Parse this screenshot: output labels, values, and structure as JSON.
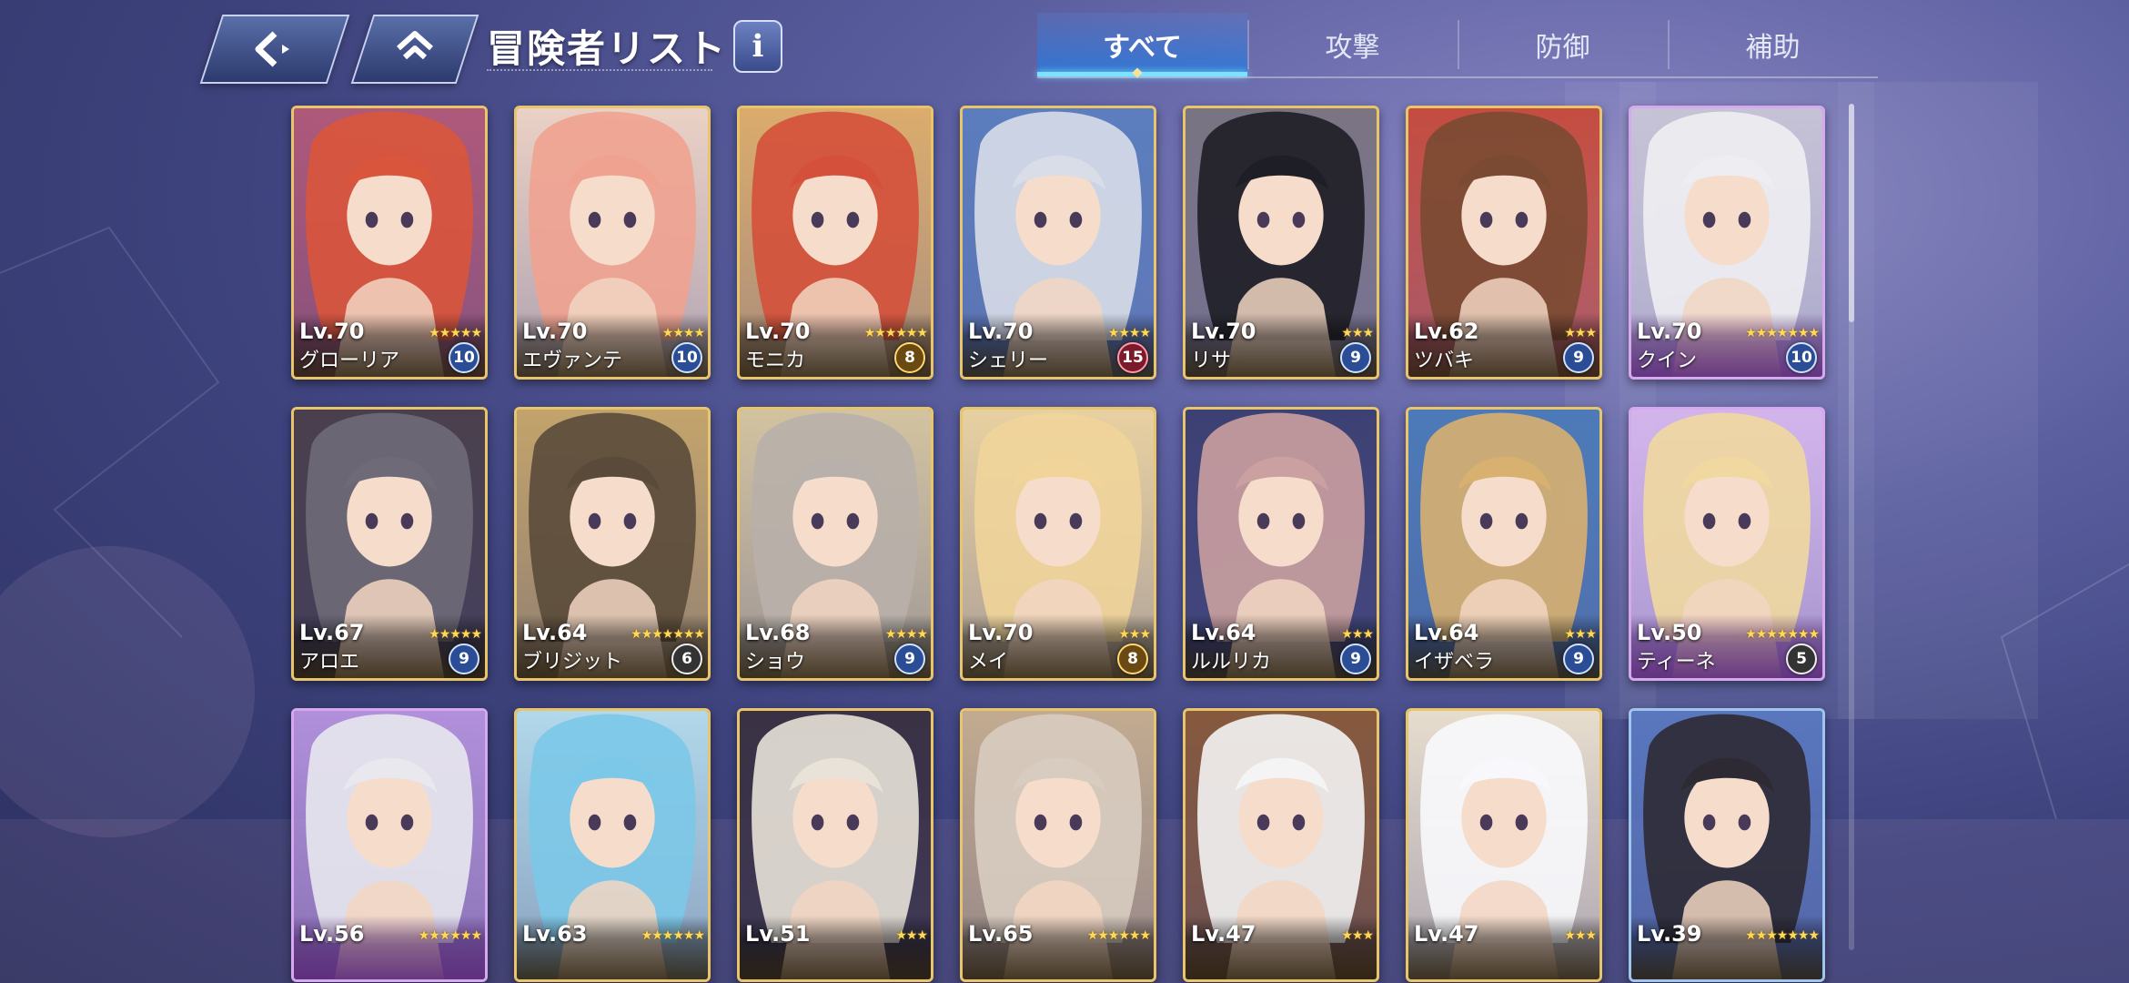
{
  "header": {
    "title": "冒険者リスト",
    "info_label": "i",
    "tabs": [
      {
        "label": "すべて",
        "active": true
      },
      {
        "label": "攻撃",
        "active": false
      },
      {
        "label": "防御",
        "active": false
      },
      {
        "label": "補助",
        "active": false
      }
    ]
  },
  "colors": {
    "frame_gold": "#e8c56a",
    "frame_purple": "#d6a8f0",
    "tab_active": "#2878dc",
    "star": "#ffd85a"
  },
  "cards": [
    {
      "level": "Lv.70",
      "stars": 5,
      "name": "グローリア",
      "badge": "10",
      "badge_style": "blue",
      "frame": "gold",
      "hue": "#d9553b",
      "bg": "#b45a7a"
    },
    {
      "level": "Lv.70",
      "stars": 4,
      "name": "エヴァンテ",
      "badge": "10",
      "badge_style": "blue",
      "frame": "gold",
      "hue": "#f0a290",
      "bg": "#f3d8c8"
    },
    {
      "level": "Lv.70",
      "stars": 6,
      "name": "モニカ",
      "badge": "8",
      "badge_style": "gold",
      "frame": "gold",
      "hue": "#d4503a",
      "bg": "#e2b06a"
    },
    {
      "level": "Lv.70",
      "stars": 4,
      "name": "シェリー",
      "badge": "15",
      "badge_style": "red",
      "frame": "gold",
      "hue": "#d8dde8",
      "bg": "#5b7fbf"
    },
    {
      "level": "Lv.70",
      "stars": 3,
      "name": "リサ",
      "badge": "9",
      "badge_style": "blue",
      "frame": "gold",
      "hue": "#1e1e26",
      "bg": "#7a7480"
    },
    {
      "level": "Lv.62",
      "stars": 3,
      "name": "ツバキ",
      "badge": "9",
      "badge_style": "blue",
      "frame": "gold",
      "hue": "#7a4a32",
      "bg": "#c84a3a"
    },
    {
      "level": "Lv.70",
      "stars": 7,
      "name": "クイン",
      "badge": "10",
      "badge_style": "blue",
      "frame": "purple",
      "hue": "#eeeef2",
      "bg": "#c9c6d8"
    },
    {
      "level": "Lv.67",
      "stars": 5,
      "name": "アロエ",
      "badge": "9",
      "badge_style": "blue",
      "frame": "gold",
      "hue": "#6e6a78",
      "bg": "#4a3f4a"
    },
    {
      "level": "Lv.64",
      "stars": 7,
      "name": "ブリジット",
      "badge": "6",
      "badge_style": "gray",
      "frame": "gold",
      "hue": "#5a4a3a",
      "bg": "#c9a86a"
    },
    {
      "level": "Lv.68",
      "stars": 4,
      "name": "ショウ",
      "badge": "9",
      "badge_style": "blue",
      "frame": "gold",
      "hue": "#b8b0aa",
      "bg": "#d9c8a0"
    },
    {
      "level": "Lv.70",
      "stars": 3,
      "name": "メイ",
      "badge": "8",
      "badge_style": "gold",
      "frame": "gold",
      "hue": "#f0d49a",
      "bg": "#efd6a0"
    },
    {
      "level": "Lv.64",
      "stars": 3,
      "name": "ルルリカ",
      "badge": "9",
      "badge_style": "blue",
      "frame": "gold",
      "hue": "#caa0a0",
      "bg": "#3a3e70"
    },
    {
      "level": "Lv.64",
      "stars": 3,
      "name": "イザベラ",
      "badge": "9",
      "badge_style": "blue",
      "frame": "gold",
      "hue": "#d8b070",
      "bg": "#4a7ab8"
    },
    {
      "level": "Lv.50",
      "stars": 7,
      "name": "ティーネ",
      "badge": "5",
      "badge_style": "gray",
      "frame": "purple",
      "hue": "#f0d8a0",
      "bg": "#d7b8ee"
    },
    {
      "level": "Lv.56",
      "stars": 6,
      "name": "",
      "badge": "",
      "badge_style": "",
      "frame": "purple",
      "hue": "#e8e8ee",
      "bg": "#b894e0"
    },
    {
      "level": "Lv.63",
      "stars": 6,
      "name": "",
      "badge": "",
      "badge_style": "",
      "frame": "gold",
      "hue": "#7cc8e8",
      "bg": "#b8e0f0"
    },
    {
      "level": "Lv.51",
      "stars": 3,
      "name": "",
      "badge": "",
      "badge_style": "",
      "frame": "gold",
      "hue": "#e8e2d8",
      "bg": "#3a3040"
    },
    {
      "level": "Lv.65",
      "stars": 6,
      "name": "",
      "badge": "",
      "badge_style": "",
      "frame": "gold",
      "hue": "#d8ccc0",
      "bg": "#c9b090"
    },
    {
      "level": "Lv.47",
      "stars": 3,
      "name": "",
      "badge": "",
      "badge_style": "",
      "frame": "gold",
      "hue": "#f4f4f4",
      "bg": "#8a5a3a"
    },
    {
      "level": "Lv.47",
      "stars": 3,
      "name": "",
      "badge": "",
      "badge_style": "",
      "frame": "gold",
      "hue": "#f8f8fc",
      "bg": "#efe4d0"
    },
    {
      "level": "Lv.39",
      "stars": 7,
      "name": "",
      "badge": "",
      "badge_style": "",
      "frame": "blue",
      "hue": "#2e2a34",
      "bg": "#5a78c0"
    }
  ]
}
